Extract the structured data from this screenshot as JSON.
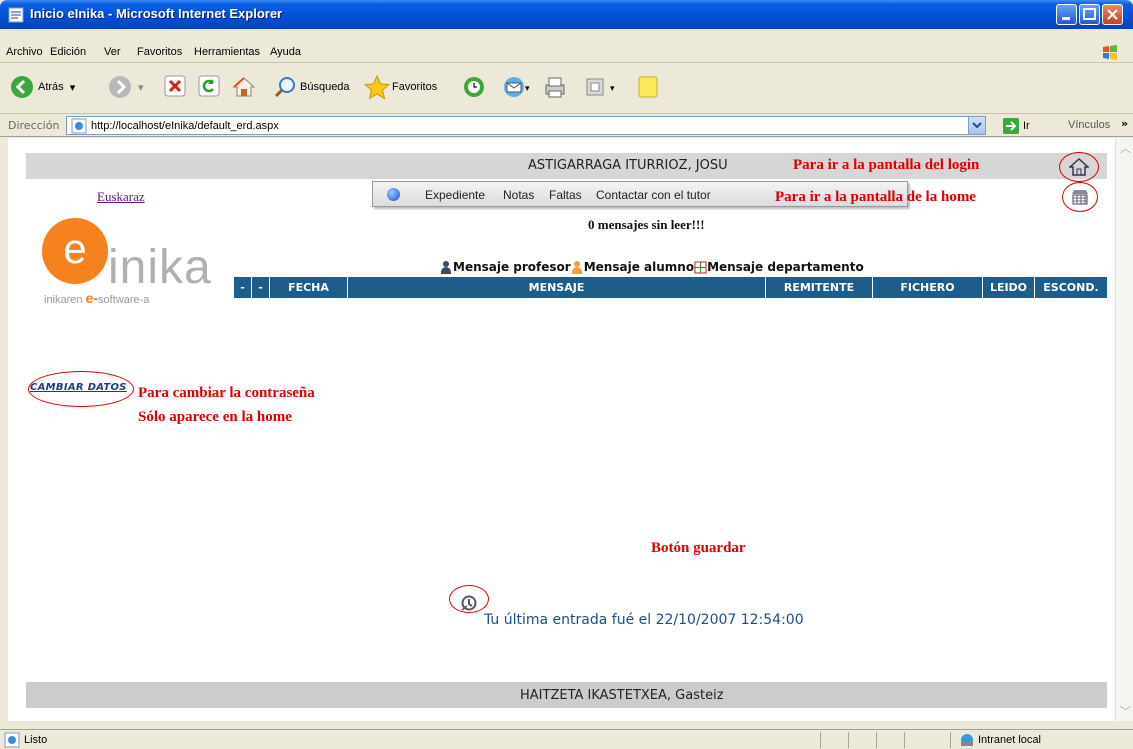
{
  "window": {
    "title": "Inicio eInika - Microsoft Internet Explorer"
  },
  "menu": [
    "Archivo",
    "Edición",
    "Ver",
    "Favoritos",
    "Herramientas",
    "Ayuda"
  ],
  "toolbar": {
    "back_label": "Atrás",
    "search_label": "Búsqueda",
    "favorites_label": "Favoritos"
  },
  "address": {
    "label": "Dirección",
    "url": "http://localhost/eInika/default_erd.aspx",
    "go_label": "Ir",
    "links_label": "Vínculos"
  },
  "page": {
    "user_name": "ASTIGARRAGA ITURRIOZ, JOSU",
    "language_link": "Euskaraz",
    "nav": [
      "Expediente",
      "Notas",
      "Faltas",
      "Contactar con el tutor"
    ],
    "unread_messages": "0 mensajes sin leer!!!",
    "logo": {
      "letter": "e",
      "word": "inika",
      "tagline_prefix": "inikaren ",
      "tagline_mark": "e-",
      "tagline_suffix": "software-a"
    },
    "legend": [
      "Mensaje profesor",
      "Mensaje alumno",
      "Mensaje departamento"
    ],
    "table_headers": [
      "-",
      "-",
      "FECHA",
      "MENSAJE",
      "REMITENTE",
      "FICHERO",
      "LEIDO",
      "ESCOND."
    ],
    "change_data_link": "CAMBIAR DATOS",
    "last_login": "Tu última entrada fué el 22/10/2007 12:54:00",
    "school": "HAITZETA IKASTETXEA, Gasteiz"
  },
  "annotations": {
    "login": "Para ir a la pantalla del login",
    "home": "Para ir a la pantalla de la home",
    "password_line1": "Para cambiar la contraseña",
    "password_line2": "Sólo aparece en la home",
    "save": "Botón guardar"
  },
  "status": {
    "left": "Listo",
    "zone": "Intranet local"
  },
  "colors": {
    "table_header": "#1c5d8c",
    "annotation": "#e00000",
    "logo_orange": "#f5821f"
  }
}
